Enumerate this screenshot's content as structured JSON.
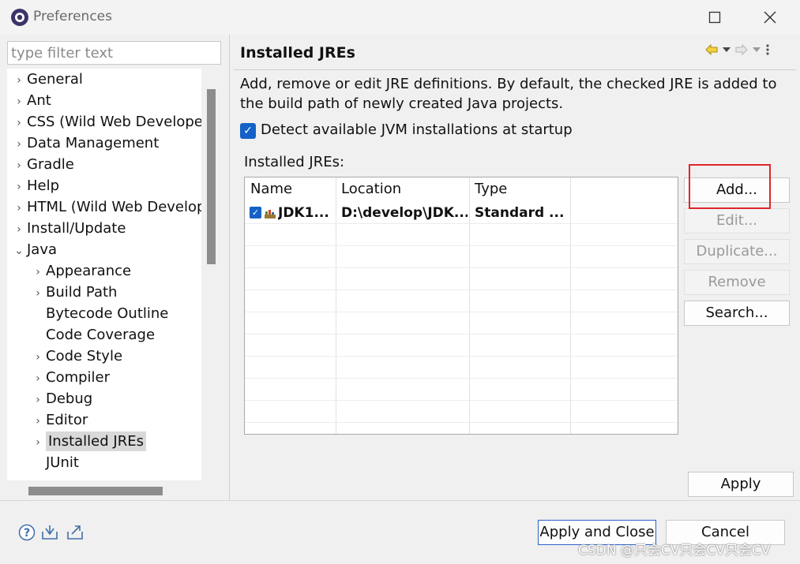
{
  "window": {
    "title": "Preferences"
  },
  "sidebar": {
    "filter_placeholder": "type filter text",
    "items": [
      {
        "label": "General"
      },
      {
        "label": "Ant"
      },
      {
        "label": "CSS (Wild Web Developer)"
      },
      {
        "label": "Data Management"
      },
      {
        "label": "Gradle"
      },
      {
        "label": "Help"
      },
      {
        "label": "HTML (Wild Web Developer)"
      },
      {
        "label": "Install/Update"
      },
      {
        "label": "Java"
      },
      {
        "label": "Appearance"
      },
      {
        "label": "Build Path"
      },
      {
        "label": "Bytecode Outline"
      },
      {
        "label": "Code Coverage"
      },
      {
        "label": "Code Style"
      },
      {
        "label": "Compiler"
      },
      {
        "label": "Debug"
      },
      {
        "label": "Editor"
      },
      {
        "label": "Installed JREs"
      },
      {
        "label": "JUnit"
      }
    ]
  },
  "page": {
    "title": "Installed JREs",
    "description": "Add, remove or edit JRE definitions. By default, the checked JRE is added to the build path of newly created Java projects.",
    "detect_checkbox_label": "Detect available JVM installations at startup",
    "detect_checked": true,
    "table_label": "Installed JREs:",
    "columns": [
      "Name",
      "Location",
      "Type"
    ],
    "rows": [
      {
        "checked": true,
        "name": "JDK1...",
        "location": "D:\\develop\\JDK...",
        "type": "Standard ..."
      }
    ]
  },
  "buttons": {
    "add": "Add...",
    "edit": "Edit...",
    "duplicate": "Duplicate...",
    "remove": "Remove",
    "search": "Search...",
    "apply": "Apply",
    "apply_close": "Apply and Close",
    "cancel": "Cancel"
  },
  "colors": {
    "accent": "#1462c7",
    "highlight_box": "#e0262b"
  },
  "watermark": "CSDN @只会CV只会CV只会CV"
}
